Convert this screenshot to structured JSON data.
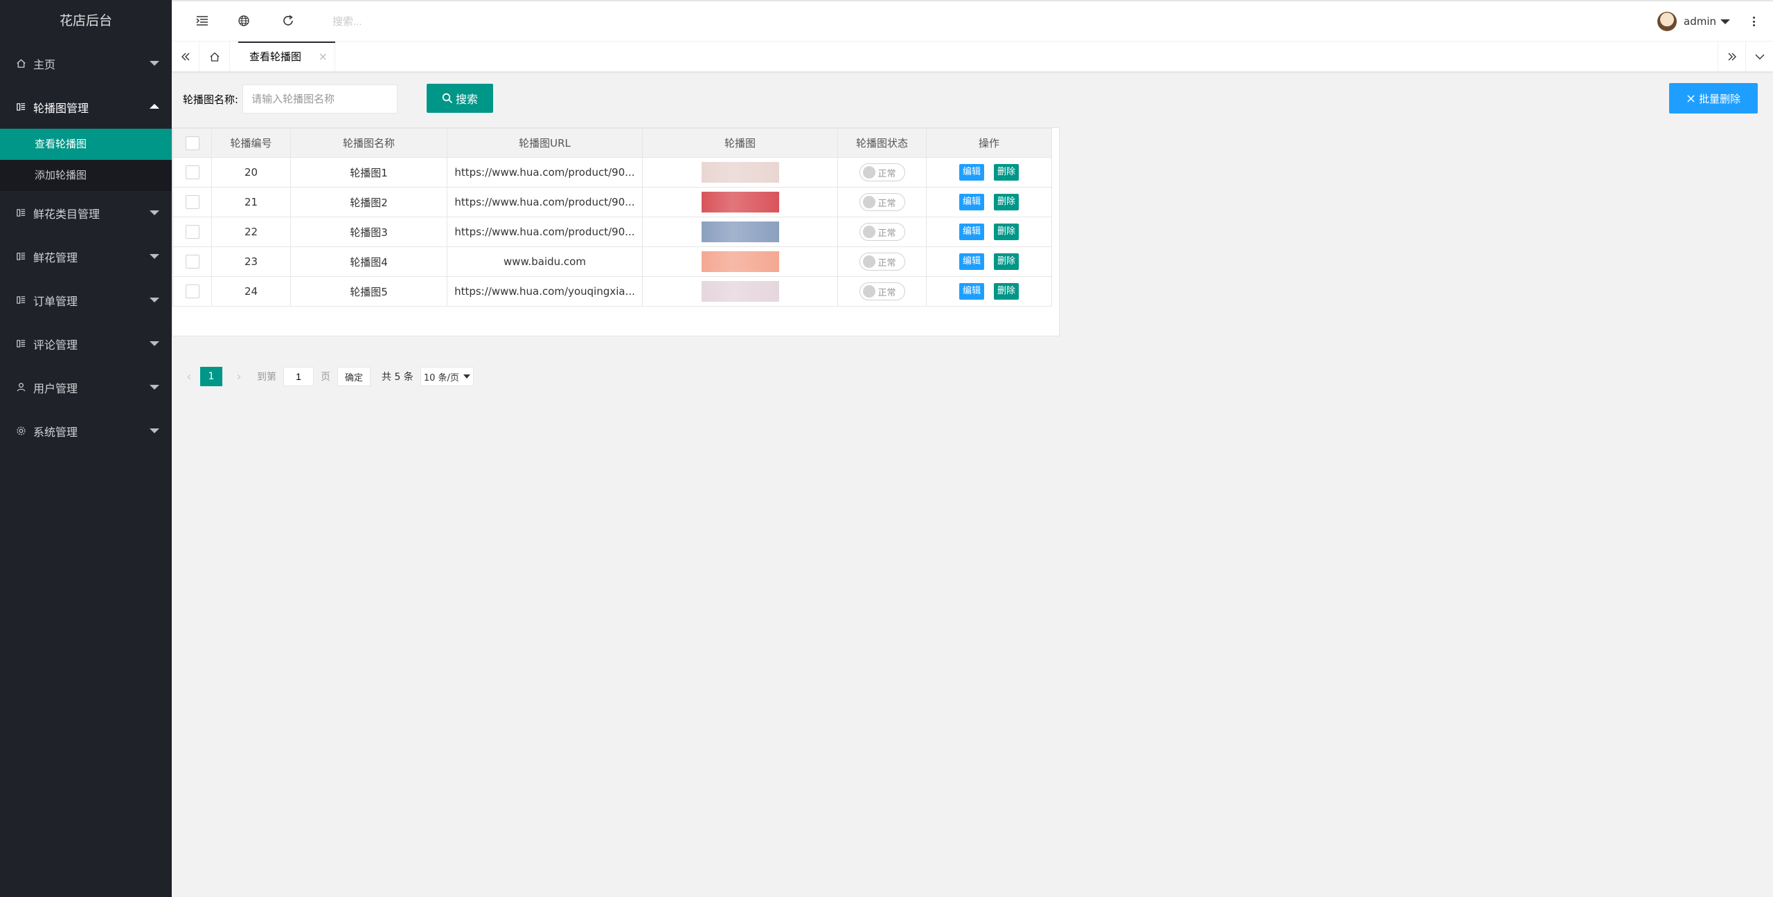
{
  "app": {
    "title": "花店后台"
  },
  "sidebar": {
    "items": [
      {
        "label": "主页",
        "icon": "home-icon"
      },
      {
        "label": "轮播图管理",
        "icon": "list-icon",
        "open": true,
        "children": [
          {
            "label": "查看轮播图",
            "active": true
          },
          {
            "label": "添加轮播图"
          }
        ]
      },
      {
        "label": "鲜花类目管理",
        "icon": "list-icon"
      },
      {
        "label": "鲜花管理",
        "icon": "list-icon"
      },
      {
        "label": "订单管理",
        "icon": "list-icon"
      },
      {
        "label": "评论管理",
        "icon": "list-icon"
      },
      {
        "label": "用户管理",
        "icon": "user-icon"
      },
      {
        "label": "系统管理",
        "icon": "gear-icon"
      }
    ]
  },
  "header": {
    "search_placeholder": "搜索...",
    "username": "admin",
    "icons": [
      "shrink-menu-icon",
      "website-globe-icon",
      "refresh-icon",
      "more-vertical-icon"
    ]
  },
  "tabs": {
    "current": "查看轮播图",
    "close": "×"
  },
  "search": {
    "label": "轮播图名称:",
    "placeholder": "请输入轮播图名称",
    "button": "搜索",
    "batch_delete": "批量删除"
  },
  "table": {
    "columns": [
      "轮播编号",
      "轮播图名称",
      "轮播图URL",
      "轮播图",
      "轮播图状态",
      "操作"
    ],
    "rows": [
      {
        "id": "20",
        "name": "轮播图1",
        "url": "https://www.hua.com/product/90...",
        "status": "正常",
        "thumb_color": "#e9d6d2"
      },
      {
        "id": "21",
        "name": "轮播图2",
        "url": "https://www.hua.com/product/90...",
        "status": "正常",
        "thumb_color": "#d9545b"
      },
      {
        "id": "22",
        "name": "轮播图3",
        "url": "https://www.hua.com/product/90...",
        "status": "正常",
        "thumb_color": "#8ba0c0"
      },
      {
        "id": "23",
        "name": "轮播图4",
        "url": "www.baidu.com",
        "status": "正常",
        "thumb_color": "#f4a892"
      },
      {
        "id": "24",
        "name": "轮播图5",
        "url": "https://www.hua.com/youqingxia...",
        "status": "正常",
        "thumb_color": "#e6d6de"
      }
    ],
    "edit_label": "编辑",
    "delete_label": "删除"
  },
  "pagination": {
    "current_page": "1",
    "goto_label": "到第",
    "goto_value": "1",
    "page_unit": "页",
    "ok_label": "确定",
    "total": "共 5 条",
    "page_size": "10 条/页"
  },
  "colors": {
    "sidebar_bg": "#20222a",
    "primary": "#009688",
    "blue": "#1e9fff"
  }
}
